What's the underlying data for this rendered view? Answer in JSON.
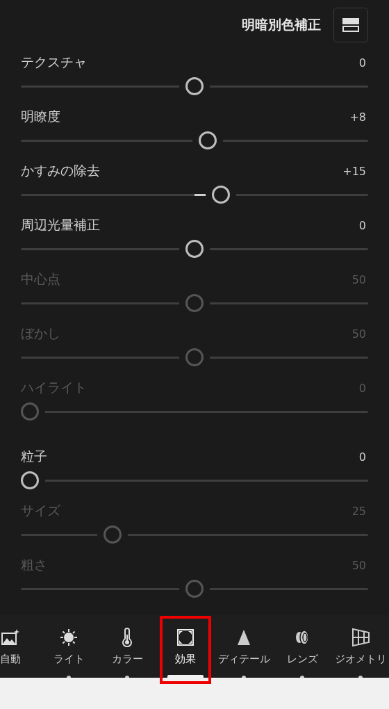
{
  "header": {
    "title": "明暗別色補正"
  },
  "groups": [
    {
      "sliders": [
        {
          "kind": "bipolar",
          "label": "テクスチャ",
          "reading": "0",
          "level": 0.5,
          "disabled": false
        },
        {
          "kind": "bipolar",
          "label": "明瞭度",
          "reading": "+8",
          "level": 0.54,
          "disabled": false
        },
        {
          "kind": "bipolar",
          "label": "かすみの除去",
          "reading": "+15",
          "level": 0.58,
          "disabled": false
        },
        {
          "kind": "bipolar",
          "label": "周辺光量補正",
          "reading": "0",
          "level": 0.5,
          "disabled": false
        },
        {
          "kind": "unipolar",
          "label": "中心点",
          "reading": "50",
          "level": 0.5,
          "disabled": true
        },
        {
          "kind": "unipolar",
          "label": "ぼかし",
          "reading": "50",
          "level": 0.5,
          "disabled": true
        },
        {
          "kind": "unipolar",
          "label": "ハイライト",
          "reading": "0",
          "level": 0,
          "disabled": true
        }
      ]
    },
    {
      "sliders": [
        {
          "kind": "unipolar",
          "label": "粒子",
          "reading": "0",
          "level": 0,
          "disabled": false
        },
        {
          "kind": "unipolar",
          "label": "サイズ",
          "reading": "25",
          "level": 0.25,
          "disabled": true
        },
        {
          "kind": "unipolar",
          "label": "粗さ",
          "reading": "50",
          "level": 0.5,
          "disabled": true
        }
      ]
    }
  ],
  "tabs": [
    {
      "kind": "auto",
      "label": "自動",
      "selected": false,
      "modified": false,
      "highlighted": false
    },
    {
      "kind": "light",
      "label": "ライト",
      "selected": false,
      "modified": true,
      "highlighted": false
    },
    {
      "kind": "color",
      "label": "カラー",
      "selected": false,
      "modified": true,
      "highlighted": false
    },
    {
      "kind": "effects",
      "label": "効果",
      "selected": true,
      "highlighted": true
    },
    {
      "kind": "detail",
      "label": "ディテール",
      "selected": false,
      "modified": true,
      "highlighted": false
    },
    {
      "kind": "lens",
      "label": "レンズ",
      "selected": false,
      "modified": true,
      "highlighted": false
    },
    {
      "kind": "geometry",
      "label": "ジオメトリ",
      "selected": false,
      "modified": true,
      "highlighted": false
    }
  ]
}
